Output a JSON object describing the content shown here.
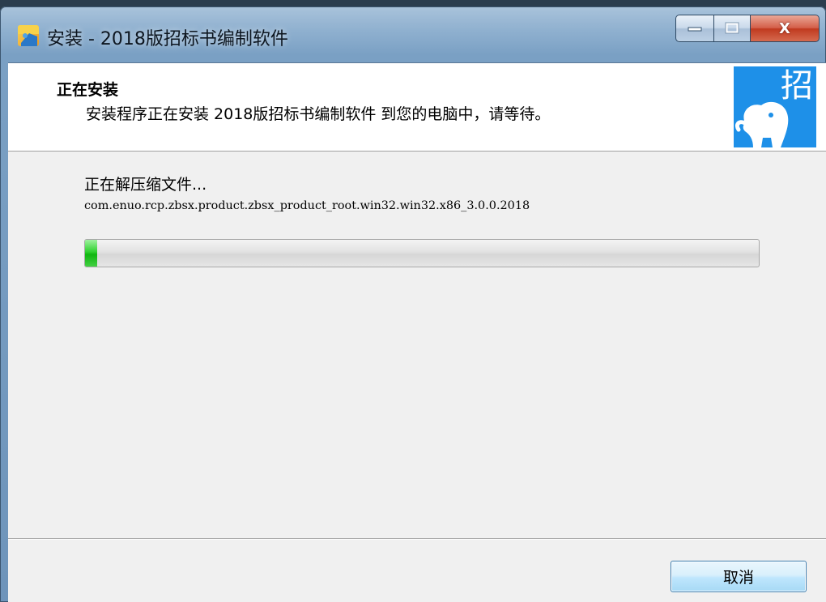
{
  "window": {
    "title": "安装 - 2018版招标书编制软件"
  },
  "caption_buttons": {
    "close_label": "X"
  },
  "header": {
    "title": "正在安装",
    "subtitle": "安装程序正在安装 2018版招标书编制软件 到您的电脑中，请等待。",
    "logo_char": "招"
  },
  "main": {
    "status": "正在解压缩文件...",
    "current_file": "com.enuo.rcp.zbsx.product.zbsx_product_root.win32.win32.x86_3.0.0.2018",
    "progress_percent": 1.8
  },
  "footer": {
    "cancel_label": "取消"
  },
  "colors": {
    "logo_bg": "#1e90e8",
    "progress_fill": "#10b510",
    "close_button": "#c03a1f"
  }
}
